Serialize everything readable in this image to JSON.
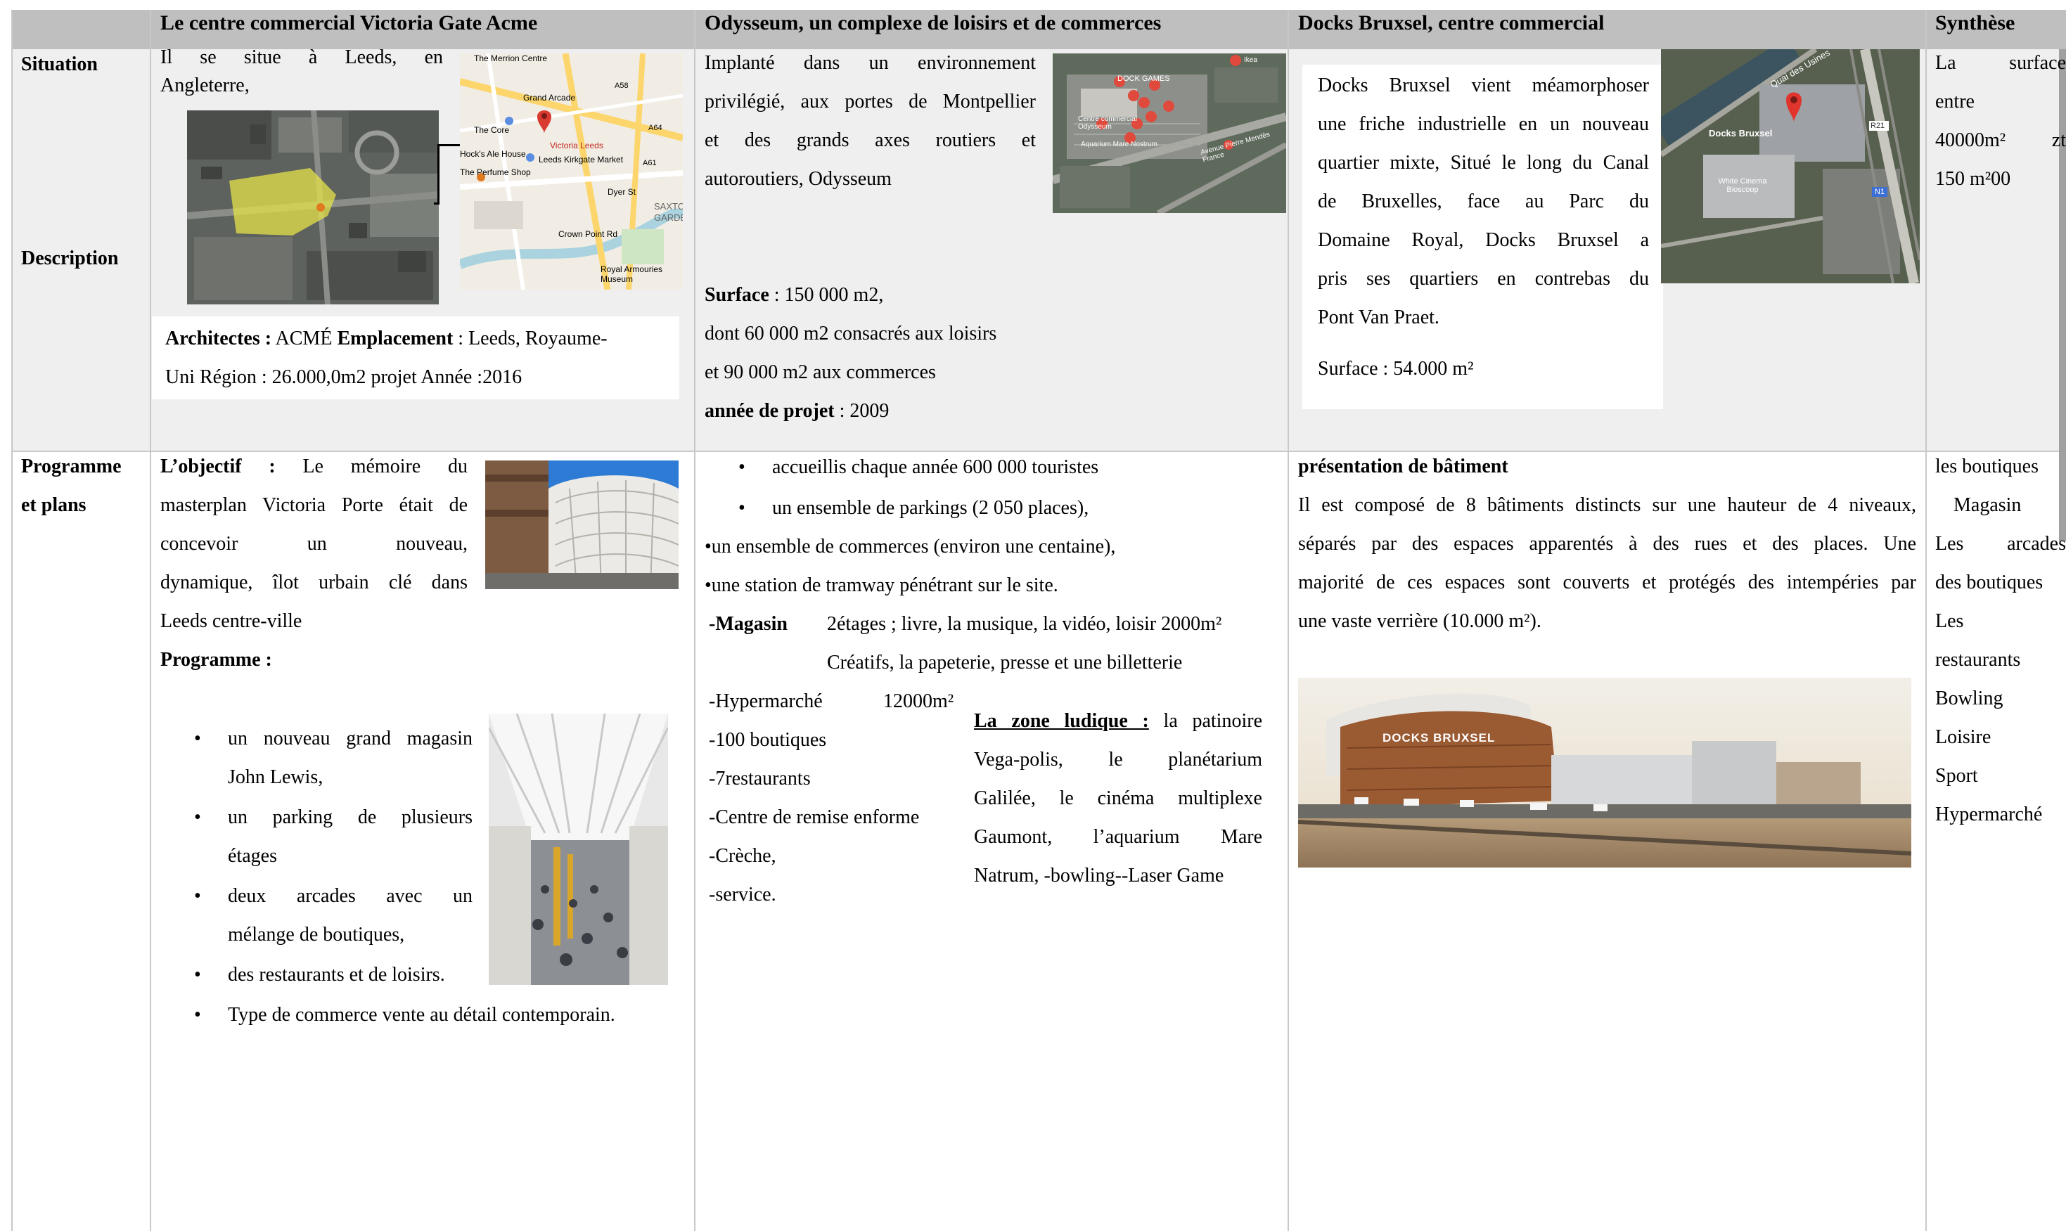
{
  "header": {
    "col_leeds": "Le centre commercial Victoria Gate Acme",
    "col_odysseum": "Odysseum, un complexe de loisirs et de commerces",
    "col_docks": "Docks Bruxsel, centre commercial",
    "col_synthese": "Synthèse"
  },
  "row_labels": {
    "situation": "Situation",
    "description": "Description",
    "programme_1": "Programme",
    "programme_2": "et plans"
  },
  "leeds": {
    "situation_1": "Il se situe à Leeds, en",
    "situation_2": "Angleterre,",
    "architects_label": "Architectes :",
    "architects_value": " ACMÉ ",
    "location_label": "Emplacement",
    "location_value": " : Leeds, Royaume-",
    "line2": "Uni Région : 26.000,0m2   projet Année :2016",
    "map_labels": [
      "The Merrion Centre",
      "Grand Arcade",
      "The Core",
      "Victoria Leeds",
      "Leeds Kirkgate Market",
      "Hock's Ale House",
      "The Perfume Shop",
      "SAXTON",
      "GARDE",
      "A61",
      "A64",
      "A58",
      "Royal Armouries Museum",
      "Crown Point Rd",
      "Dyer St"
    ],
    "objectif_label": "L’objectif :",
    "objectif_lines": [
      " Le mémoire du",
      "masterplan Victoria Porte était de",
      "concevoir un nouveau,",
      "dynamique, îlot urbain clé dans",
      "Leeds centre-ville"
    ],
    "programme_label": "Programme :",
    "bullets": [
      [
        "un nouveau grand magasin",
        "John Lewis,"
      ],
      [
        "un parking de plusieurs",
        "étages"
      ],
      [
        "deux arcades avec un",
        "mélange de boutiques,"
      ],
      [
        "des restaurants et de loisirs."
      ],
      [
        "Type de commerce vente au détail contemporain."
      ]
    ]
  },
  "odysseum": {
    "situation_lines": [
      "Implanté dans un environnement",
      "privilégié, aux portes de Montpellier",
      "et des grands axes routiers et",
      "autoroutiers, Odysseum"
    ],
    "map_labels": [
      "DOCK GAMES",
      "Centre commercial Odysseum",
      "Aquarium Mare Nostrum",
      "Ikea",
      "Avenue Pierre Mendès France"
    ],
    "surface_label": "Surface",
    "surface_value": " : 150 000 m2,",
    "surface_lines": [
      "dont 60 000 m2 consacrés aux loisirs",
      "et 90 000 m2 aux commerces"
    ],
    "annee_label": "année de projet",
    "annee_value": " : 2009",
    "bullets": [
      "accueillis chaque année 600 000 touristes",
      "un ensemble de parkings (2 050 places),"
    ],
    "dot_lines": [
      "•un ensemble de commerces (environ une centaine),",
      "•une station de tramway pénétrant sur le site."
    ],
    "magasin_label": "-Magasin",
    "magasin_lines": [
      "2étages ; livre, la musique, la vidéo, loisir 2000m²",
      "Créatifs, la papeterie, presse et une billetterie"
    ],
    "hyper_label": "-Hypermarché",
    "hyper_value": "12000m²",
    "list": [
      "-100 boutiques",
      "-7restaurants",
      "-Centre de remise enforme",
      "-Crèche,",
      "-service."
    ],
    "ludique_label": "La zone ludique :",
    "ludique_lines": [
      " la patinoire",
      "Vega-polis, le planétarium",
      "Galilée, le cinéma multiplexe",
      "Gaumont, l’aquarium Mare",
      "Natrum, -bowling--Laser Game"
    ]
  },
  "docks": {
    "desc_lines": [
      "Docks Bruxsel vient méamorphoser",
      "une friche industrielle en un nouveau",
      "quartier mixte, Situé le long du Canal",
      "de Bruxelles, face au Parc du",
      "Domaine Royal, Docks Bruxsel a",
      "pris ses quartiers en contrebas du",
      "Pont Van Praet."
    ],
    "surface": "Surface : 54.000 m²",
    "map_labels": [
      "Docks Bruxsel",
      "Quai des Usines",
      "White Cinema Bioscoop",
      "R21",
      "N1"
    ],
    "presentation_label": "présentation de bâtiment",
    "presentation_lines": [
      "Il est composé de 8 bâtiments distincts sur une hauteur de 4 niveaux,",
      "séparés par des espaces apparentés à des rues et des places. Une",
      "majorité de ces espaces sont couverts et protégés des intempéries par",
      "une vaste verrière (10.000 m²)."
    ],
    "photo_sign": "DOCKS BRUXSEL"
  },
  "synthese": {
    "situation_lines": [
      "La surface",
      "entre",
      "40000m² zt",
      "150 m²00"
    ],
    "programme_lines": [
      "les boutiques",
      "Magasin",
      "Les arcades",
      "des boutiques",
      "Les",
      "restaurants",
      "Bowling",
      "Loisire",
      "Sport",
      "Hypermarché"
    ]
  },
  "colors": {
    "header_bg": "#bfbfbf",
    "row_bg": "#efefef",
    "grid": "#c8c8c8",
    "marker_red": "#d93b30",
    "highlight_yellow": "#e5e34a"
  }
}
